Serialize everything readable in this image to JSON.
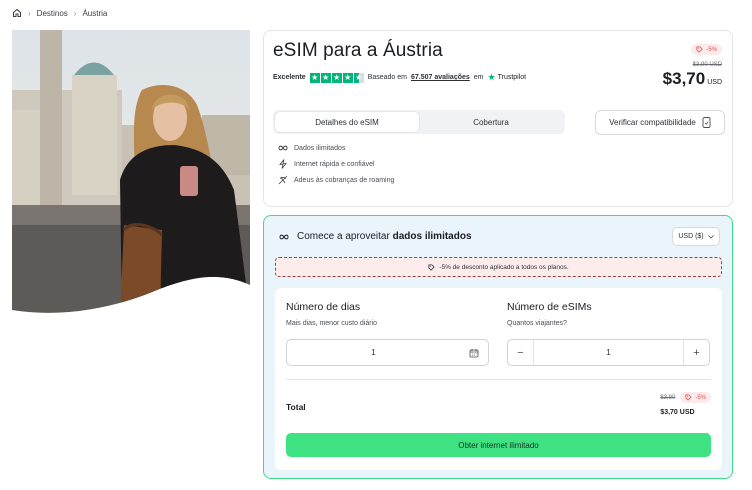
{
  "breadcrumb": {
    "items": [
      "Destinos",
      "Áustria"
    ]
  },
  "product": {
    "title": "eSIM para a Áustria",
    "trust_rating": "Excelente",
    "trust_based_on": "Baseado em",
    "trust_reviews": "67.507 avaliações",
    "trust_in": "em",
    "trust_brand": "Trustpilot",
    "discount_badge": "-5%",
    "old_price": "$3,90 USD",
    "price": "$3,70",
    "price_currency": "USD"
  },
  "tabs": [
    {
      "label": "Detalhes do eSIM",
      "active": true
    },
    {
      "label": "Cobertura",
      "active": false
    }
  ],
  "verify_button": "Verificar compatibilidade",
  "features": [
    {
      "icon": "infinity-icon",
      "label": "Dados ilimitados"
    },
    {
      "icon": "lightning-icon",
      "label": "Internet rápida e confiável"
    },
    {
      "icon": "no-roaming-icon",
      "label": "Adeus às cobranças de roaming"
    }
  ],
  "plan": {
    "heading_prefix": "Comece a aproveitar",
    "heading_bold": "dados ilimitados",
    "currency_select": "USD ($)",
    "discount_notice": "-5% de desconto aplicado a todos os planos.",
    "days_label": "Número de dias",
    "days_sub": "Mais dias, menor custo diário",
    "days_value": "1",
    "esims_label": "Número de eSIMs",
    "esims_sub": "Quantos viajantes?",
    "esims_value": "1",
    "minus": "−",
    "plus": "+",
    "total_label": "Total",
    "total_old": "$3,90",
    "total_badge": "-5%",
    "total_price": "$3,70 USD",
    "cta": "Obter internet ilimitado"
  },
  "colors": {
    "accent_green": "#3ee282",
    "trustpilot_green": "#00b67a",
    "discount_red": "#d9534f",
    "panel_bg": "#eaf4fb"
  }
}
